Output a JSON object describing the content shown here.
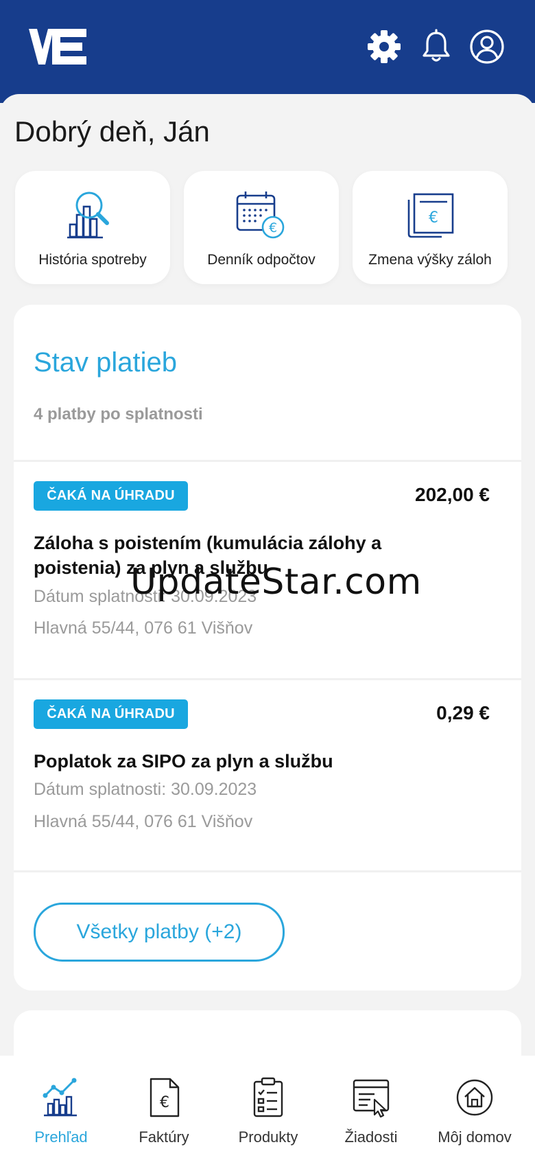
{
  "header": {
    "logo_text": "VSE",
    "icons": [
      "gear-icon",
      "bell-icon",
      "user-icon"
    ]
  },
  "greeting": "Dobrý deň, Ján",
  "tiles": [
    {
      "label": "História spotreby",
      "icon": "consumption-history-icon"
    },
    {
      "label": "Denník odpočtov",
      "icon": "calendar-euro-icon"
    },
    {
      "label": "Zmena výšky záloh",
      "icon": "invoice-euro-icon"
    }
  ],
  "payments": {
    "title": "Stav platieb",
    "subtitle": "4 platby po splatnosti",
    "items": [
      {
        "status": "ČAKÁ NA ÚHRADU",
        "amount": "202,00 €",
        "title": "Záloha s poistením (kumulácia zálohy a poistenia) za plyn a službu",
        "due": "Dátum splatnosti: 30.09.2023",
        "address": "Hlavná 55/44, 076 61 Višňov"
      },
      {
        "status": "ČAKÁ NA ÚHRADU",
        "amount": "0,29 €",
        "title": "Poplatok za SIPO za plyn a službu",
        "due": "Dátum splatnosti: 30.09.2023",
        "address": "Hlavná 55/44, 076 61 Višňov"
      }
    ],
    "all_button": "Všetky platby (+2)"
  },
  "watermark": "UpdateStar.com",
  "nav": [
    {
      "label": "Prehľad",
      "icon": "chart-icon",
      "active": true
    },
    {
      "label": "Faktúry",
      "icon": "invoice-icon",
      "active": false
    },
    {
      "label": "Produkty",
      "icon": "clipboard-icon",
      "active": false
    },
    {
      "label": "Žiadosti",
      "icon": "request-icon",
      "active": false
    },
    {
      "label": "Môj domov",
      "icon": "home-icon",
      "active": false
    }
  ],
  "colors": {
    "header_bg": "#173d8c",
    "accent": "#2aa6dc",
    "badge": "#19a7e0",
    "muted": "#9a9a9a"
  }
}
